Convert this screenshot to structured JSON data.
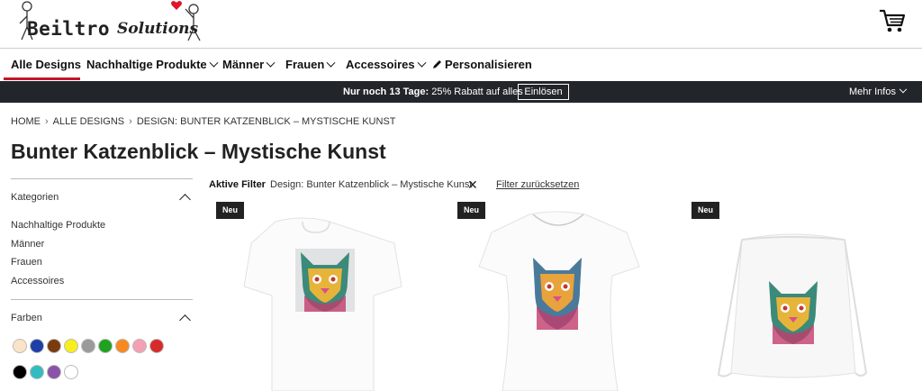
{
  "header": {
    "logo_text": "Beiltro",
    "logo_text2": "Solutions"
  },
  "nav": {
    "items": [
      {
        "label": "Alle Designs",
        "dropdown": false
      },
      {
        "label": "Nachhaltige Produkte",
        "dropdown": true
      },
      {
        "label": "Männer",
        "dropdown": true
      },
      {
        "label": "Frauen",
        "dropdown": true
      },
      {
        "label": "Accessoires",
        "dropdown": true
      },
      {
        "label": "Personalisieren",
        "dropdown": false,
        "icon": "pencil-icon"
      }
    ]
  },
  "promo": {
    "bold": "Nur noch 13 Tage:",
    "text": "25% Rabatt auf alles",
    "button": "Einlösen",
    "more": "Mehr Infos"
  },
  "breadcrumb": [
    "HOME",
    "ALLE DESIGNS",
    "DESIGN: BUNTER KATZENBLICK – MYSTISCHE KUNST"
  ],
  "page_title": "Bunter Katzenblick – Mystische Kunst",
  "sidebar": {
    "categories_title": "Kategorien",
    "categories": [
      "Nachhaltige Produkte",
      "Männer",
      "Frauen",
      "Accessoires"
    ],
    "colors_title": "Farben",
    "colors": [
      "#fbe3c8",
      "#1f3fa8",
      "#7b3a10",
      "#f6ef1b",
      "#9a9a9a",
      "#1fa21f",
      "#f7891f",
      "#f4a0b4",
      "#d72b2b",
      "#000000",
      "#33bcc0",
      "#8a52a8",
      "#ffffff"
    ]
  },
  "filters": {
    "label": "Aktive Filter",
    "chip": "Design: Bunter Katzenblick – Mystische Kunst",
    "reset": "Filter zurücksetzen"
  },
  "products": [
    {
      "badge": "Neu",
      "type": "T-Shirt"
    },
    {
      "badge": "Neu",
      "type": "Frauen T-Shirt"
    },
    {
      "badge": "Neu",
      "type": "Turnbeutel"
    }
  ]
}
